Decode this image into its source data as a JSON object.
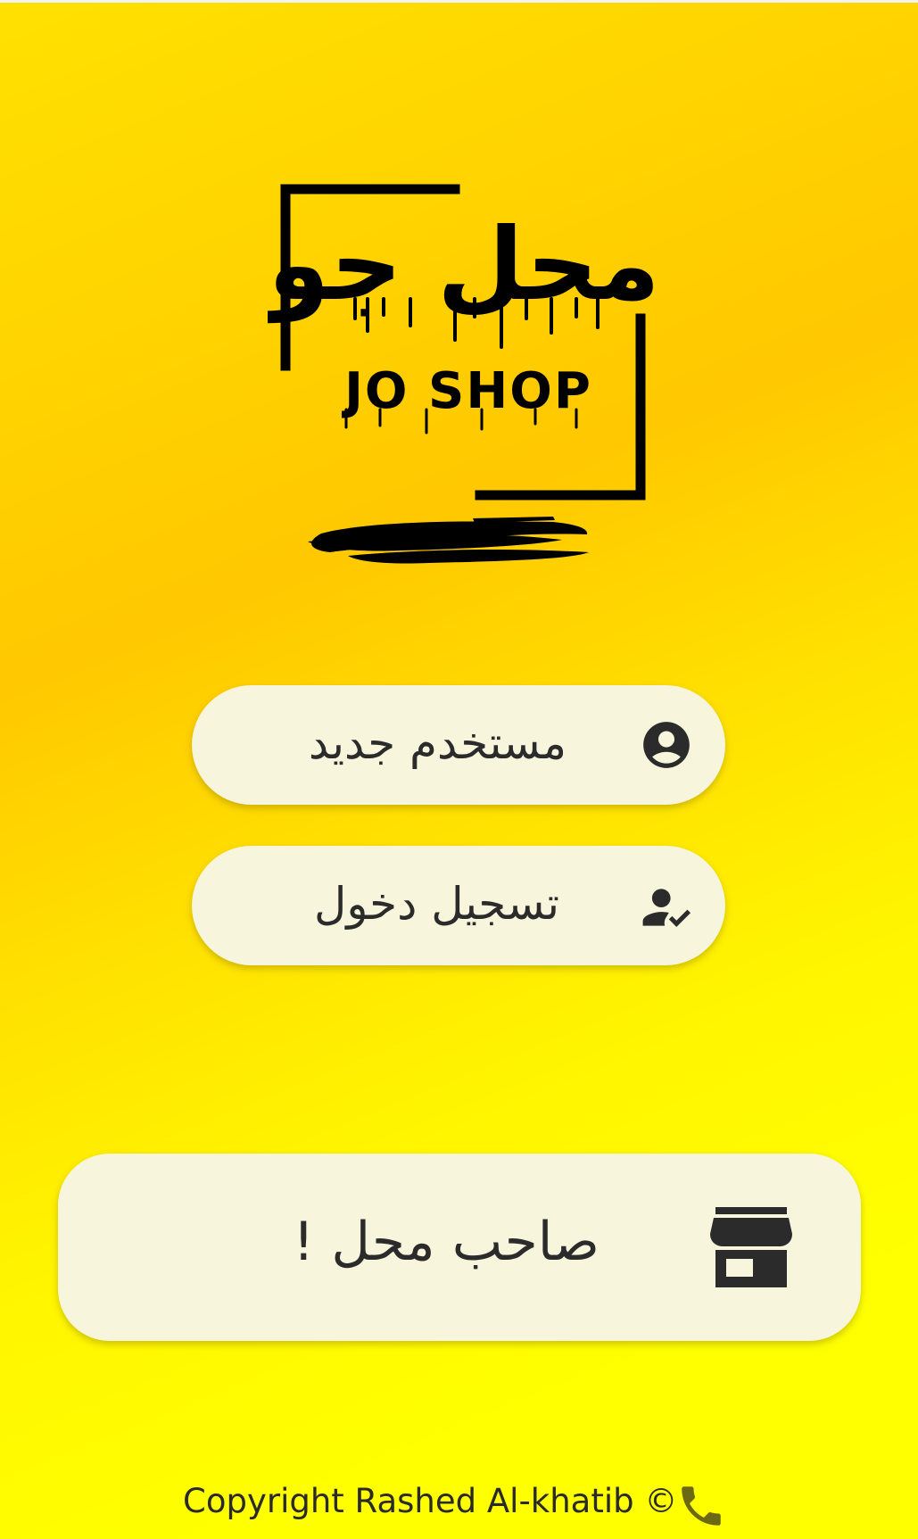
{
  "app": {
    "name_ar": "محل جو",
    "name_en": "JO SHOP"
  },
  "buttons": {
    "new_user": {
      "label": "مستخدم جديد",
      "icon": "account-circle-icon"
    },
    "login": {
      "label": "تسجيل دخول",
      "icon": "how-to-reg-icon"
    },
    "shop_owner": {
      "label": "صاحب محل !",
      "icon": "storefront-icon"
    }
  },
  "footer": {
    "copyright": "Copyright Rashed Al-khatib ©",
    "icon": "phone-icon"
  },
  "colors": {
    "background_top": "#ffd200",
    "background_bottom": "#ffff00",
    "button_bg": "#f7f5dc",
    "text": "#2b2b2b",
    "phone_icon": "#6b6a12"
  }
}
